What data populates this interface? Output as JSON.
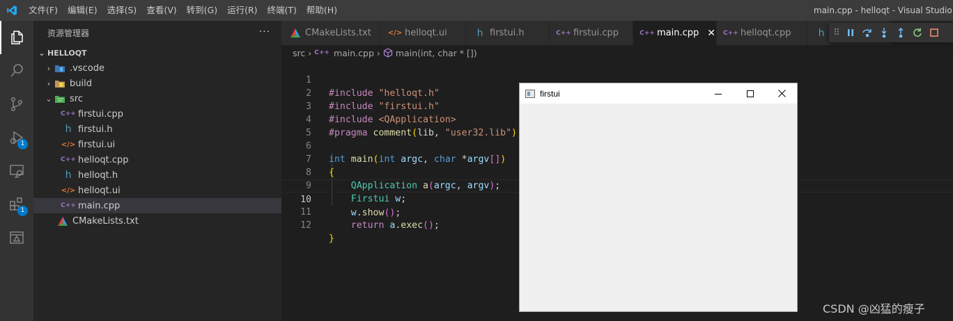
{
  "titlebar": {
    "menu": [
      "文件(F)",
      "编辑(E)",
      "选择(S)",
      "查看(V)",
      "转到(G)",
      "运行(R)",
      "终端(T)",
      "帮助(H)"
    ],
    "title": "main.cpp - helloqt - Visual Studio Co"
  },
  "activity": {
    "debug_badge": "1",
    "extensions_badge": "1"
  },
  "sidebar": {
    "header": "资源管理器",
    "more": "···",
    "section": "HELLOQT",
    "items": [
      {
        "label": ".vscode",
        "kind": "folder"
      },
      {
        "label": "build",
        "kind": "folder"
      },
      {
        "label": "src",
        "kind": "folder-open"
      },
      {
        "label": "firstui.cpp",
        "icon": "C++"
      },
      {
        "label": "firstui.h",
        "icon": "h"
      },
      {
        "label": "firstui.ui",
        "icon": "</>"
      },
      {
        "label": "helloqt.cpp",
        "icon": "C++"
      },
      {
        "label": "helloqt.h",
        "icon": "h"
      },
      {
        "label": "helloqt.ui",
        "icon": "</>"
      },
      {
        "label": "main.cpp",
        "icon": "C++"
      },
      {
        "label": "CMakeLists.txt",
        "icon": "cmake"
      }
    ]
  },
  "tabs": [
    {
      "label": "CMakeLists.txt",
      "icon": "cmake"
    },
    {
      "label": "helloqt.ui",
      "icon": "</>"
    },
    {
      "label": "firstui.h",
      "icon": "h"
    },
    {
      "label": "firstui.cpp",
      "icon": "C++"
    },
    {
      "label": "main.cpp",
      "icon": "C++",
      "active": true
    },
    {
      "label": "helloqt.cpp",
      "icon": "C++"
    },
    {
      "label": "h",
      "icon": "h"
    }
  ],
  "breadcrumb": {
    "folder": "src",
    "file": "main.cpp",
    "symbol": "main(int, char * [])"
  },
  "editor": {
    "line_numbers": [
      "1",
      "2",
      "3",
      "4",
      "5",
      "6",
      "7",
      "8",
      "9",
      "10",
      "11",
      "12"
    ],
    "current_line": "10"
  },
  "qt_window": {
    "title": "firstui"
  },
  "watermark": "CSDN @凶猛的瘦子",
  "colors": {
    "accent": "#007acc",
    "keyword": "#569cd6",
    "string": "#ce9178",
    "preproc": "#c586c0",
    "type": "#4ec9b0",
    "variable": "#9cdcfe",
    "function": "#dcdcaa"
  }
}
